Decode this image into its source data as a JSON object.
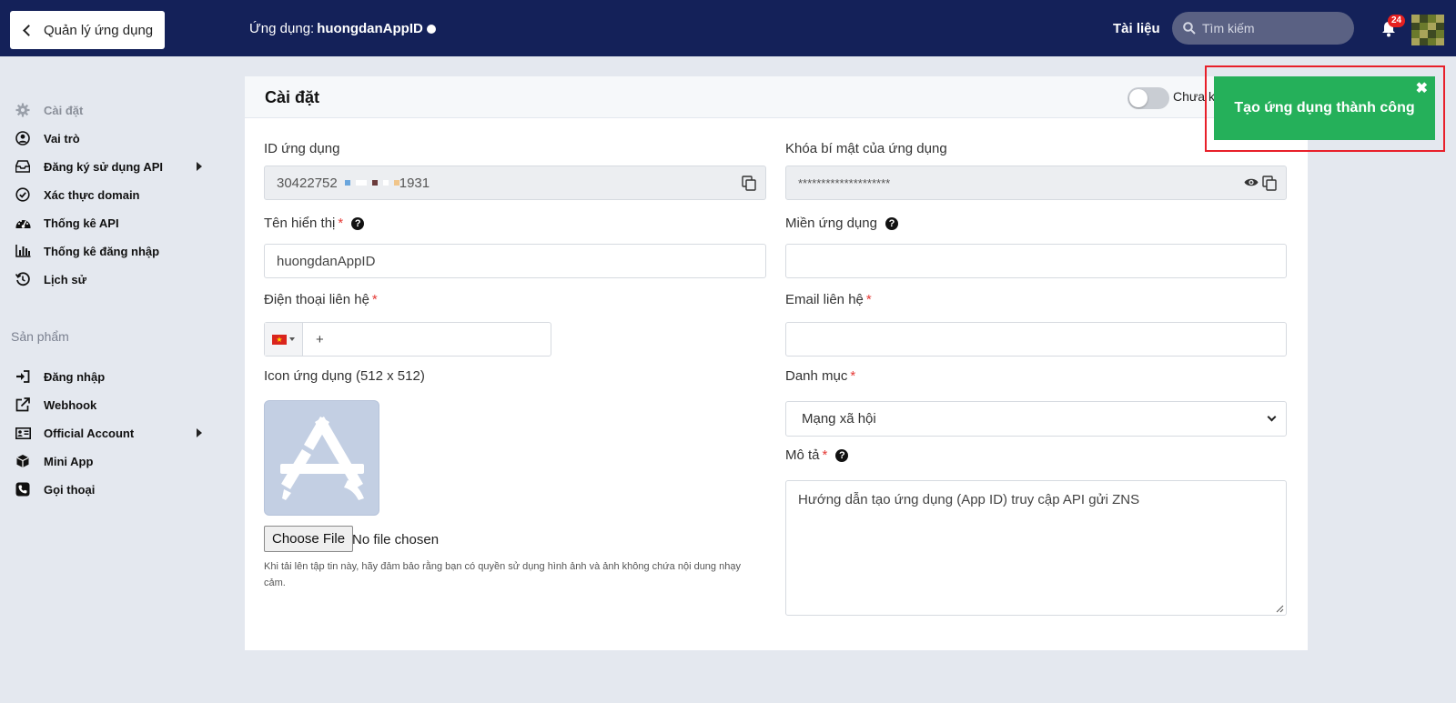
{
  "topbar": {
    "back_label": "Quản lý ứng dụng",
    "app_prefix": "Ứng dụng:",
    "app_name": "huongdanAppID",
    "docs_label": "Tài liệu",
    "search_placeholder": "Tìm kiếm",
    "notification_count": "24"
  },
  "sidebar": {
    "items": [
      {
        "label": "Cài đặt",
        "icon": "gear-icon"
      },
      {
        "label": "Vai trò",
        "icon": "user-circle-icon"
      },
      {
        "label": "Đăng ký sử dụng API",
        "icon": "inbox-icon"
      },
      {
        "label": "Xác thực domain",
        "icon": "check-circle-icon"
      },
      {
        "label": "Thống kê API",
        "icon": "dashboard-icon"
      },
      {
        "label": "Thống kê đăng nhập",
        "icon": "bar-chart-icon"
      },
      {
        "label": "Lịch sử",
        "icon": "history-icon"
      }
    ],
    "section_title": "Sản phẩm",
    "products": [
      {
        "label": "Đăng nhập",
        "icon": "sign-in-icon"
      },
      {
        "label": "Webhook",
        "icon": "external-link-icon"
      },
      {
        "label": "Official Account",
        "icon": "id-card-icon"
      },
      {
        "label": "Mini App",
        "icon": "cube-icon"
      },
      {
        "label": "Gọi thoại",
        "icon": "phone-icon"
      }
    ]
  },
  "card": {
    "title": "Cài đặt",
    "toggle_label": "Chưa kí"
  },
  "form": {
    "app_id_label": "ID ứng dụng",
    "app_id_prefix": "30422752",
    "app_id_suffix": "1931",
    "secret_label": "Khóa bí mật của ứng dụng",
    "secret_value": "********************",
    "display_name_label": "Tên hiển thị",
    "display_name_value": "huongdanAppID",
    "domain_label": "Miền ứng dụng",
    "domain_value": "",
    "phone_label": "Điện thoại liên hệ",
    "phone_value": "+",
    "email_label": "Email liên hệ",
    "email_value": "",
    "icon_label": "Icon ứng dụng (512 x 512)",
    "file_button": "Choose File",
    "file_status": "No file chosen",
    "file_note": "Khi tải lên tập tin này, hãy đảm bảo rằng bạn có quyền sử dụng hình ảnh và ảnh không chứa nội dung nhạy cảm.",
    "category_label": "Danh mục",
    "category_value": "Mạng xã hội",
    "description_label": "Mô tả",
    "description_value": "Hướng dẫn tạo ứng dụng (App ID) truy cập API gửi ZNS",
    "required_mark": "*"
  },
  "toast": {
    "message": "Tạo ứng dụng thành công",
    "close": "✖"
  },
  "colors": {
    "topbar": "#142159",
    "toast": "#25b05a",
    "highlight": "#e8202a",
    "required": "#e53935"
  }
}
